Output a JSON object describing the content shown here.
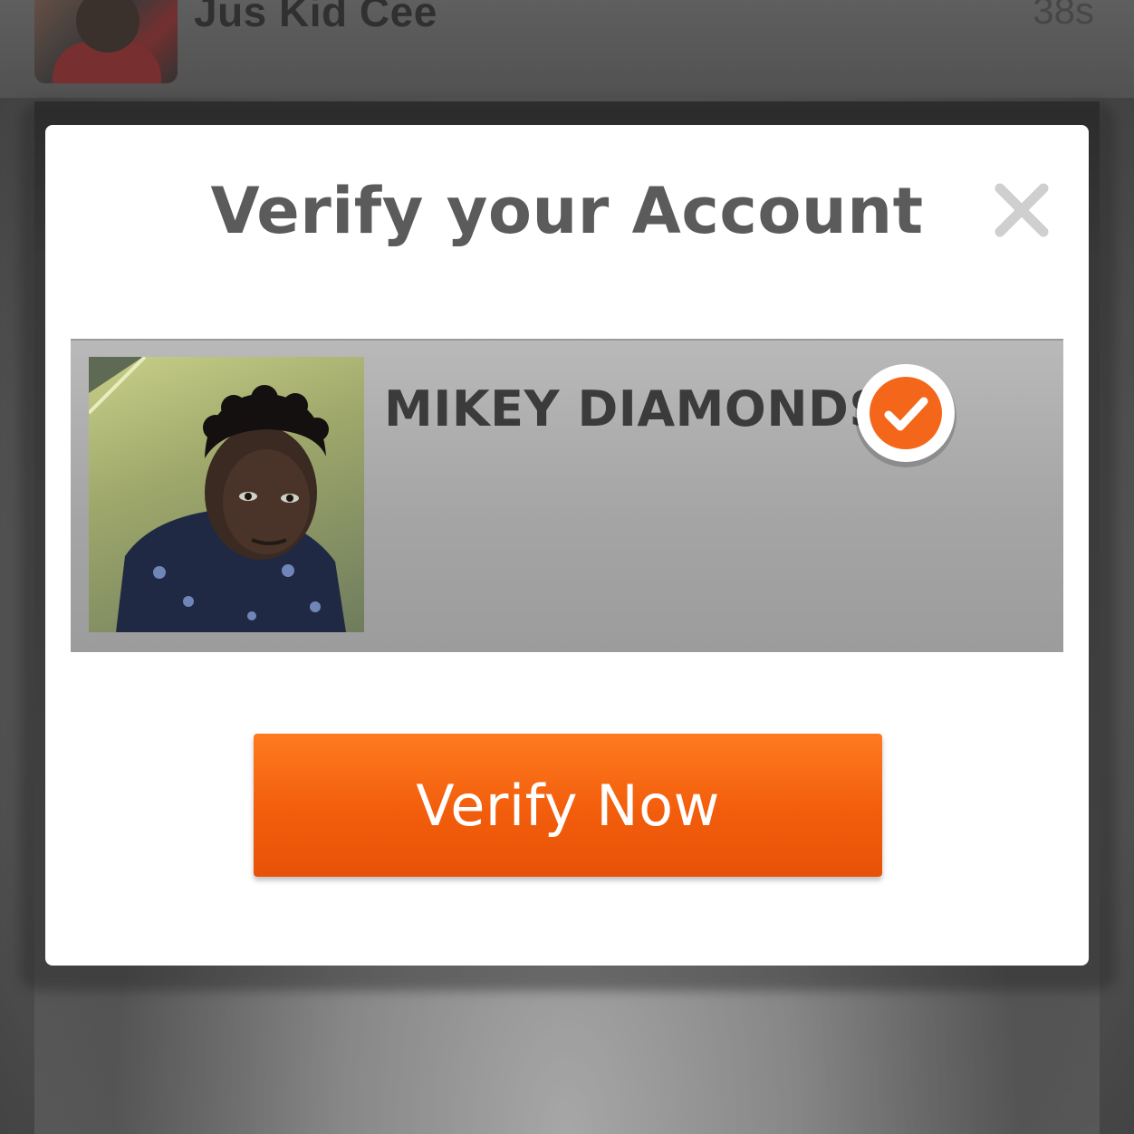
{
  "feed": {
    "username": "Jus Kid Cee",
    "timestamp": "38s"
  },
  "modal": {
    "title": "Verify your Account",
    "close_icon": "close-icon",
    "profile": {
      "name": "MIKEY DIAMONDS",
      "badge_icon": "verified-check-icon"
    },
    "verify_button_label": "Verify Now"
  },
  "colors": {
    "accent_orange": "#f25d0c",
    "title_gray": "#5b5b5b",
    "card_gray": "#a8a8a8"
  }
}
